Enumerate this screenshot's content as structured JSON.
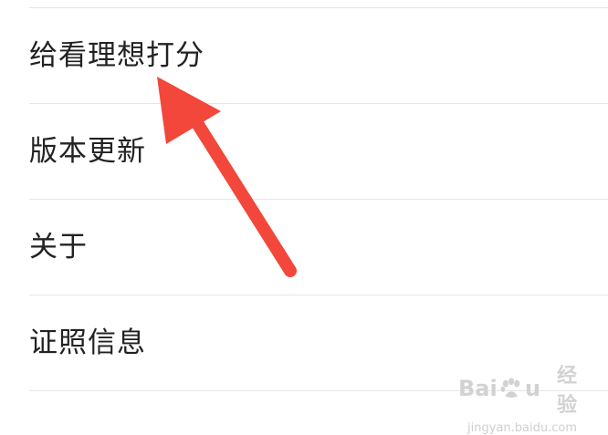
{
  "menu": {
    "items": [
      {
        "label": "给看理想打分"
      },
      {
        "label": "版本更新"
      },
      {
        "label": "关于"
      },
      {
        "label": "证照信息"
      }
    ]
  },
  "annotation": {
    "arrow_color": "#f2473a",
    "points_to": "给看理想打分"
  },
  "watermark": {
    "brand_a": "Bai",
    "brand_b": "u",
    "brand_cn": "经验",
    "url": "jingyan.baidu.com"
  },
  "colors": {
    "background": "#ffffff",
    "divider": "#e6e6e6",
    "text": "#222222"
  }
}
